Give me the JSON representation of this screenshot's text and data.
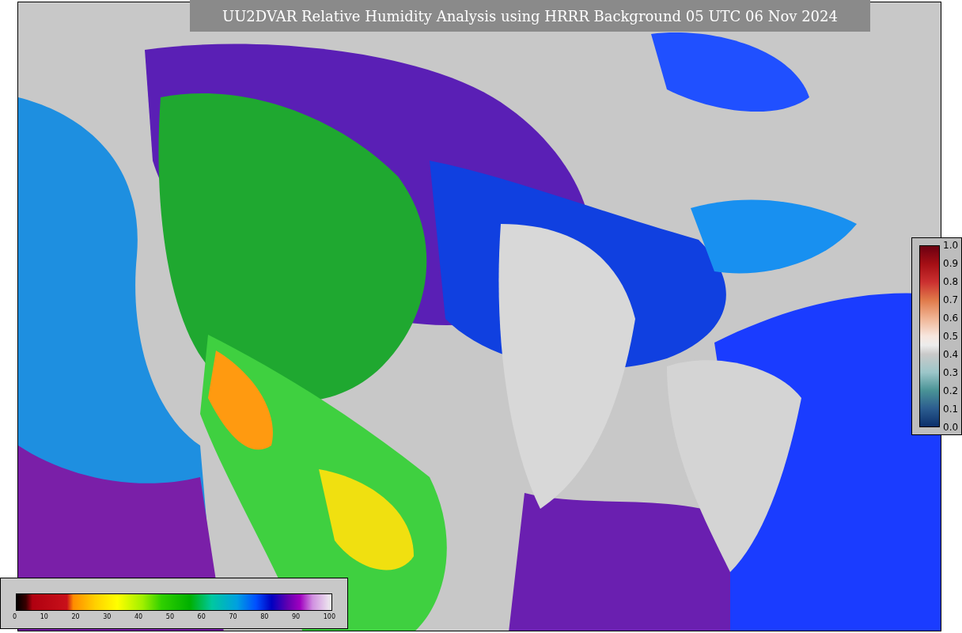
{
  "title": "UU2DVAR Relative Humidity Analysis using HRRR Background 05 UTC 06 Nov 2024",
  "error_colorbar": {
    "ticks": [
      "1.0",
      "0.9",
      "0.8",
      "0.7",
      "0.6",
      "0.5",
      "0.4",
      "0.3",
      "0.2",
      "0.1",
      "0.0"
    ]
  },
  "humidity_colorbar": {
    "ticks": [
      "0",
      "10",
      "20",
      "30",
      "40",
      "50",
      "60",
      "70",
      "80",
      "90",
      "100"
    ]
  }
}
